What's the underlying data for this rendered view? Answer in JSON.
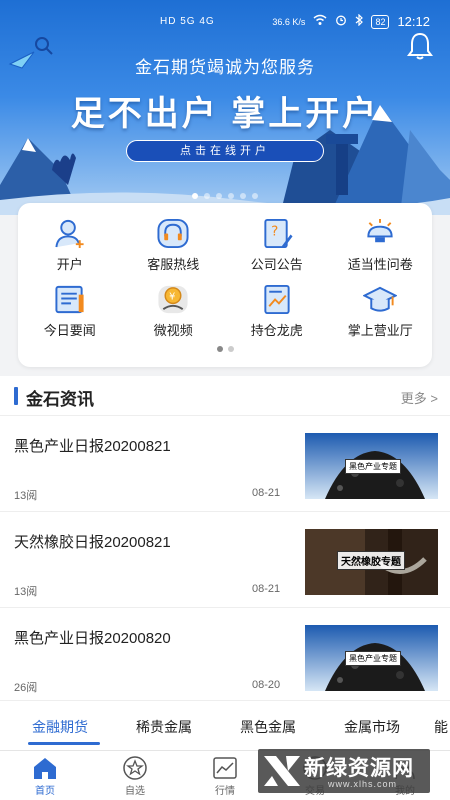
{
  "status_bar": {
    "signal": "HD 5G 4G",
    "speed": "36.6 K/s",
    "battery": "82",
    "time": "12:12"
  },
  "banner": {
    "slogan": "金石期货竭诚为您服务",
    "headline": "足不出户 掌上开户",
    "cta": "点击在线开户",
    "page_count": 6,
    "active_page": 1
  },
  "quick_menu": {
    "items": [
      {
        "label": "开户",
        "icon": "user-add-icon"
      },
      {
        "label": "客服热线",
        "icon": "headset-icon"
      },
      {
        "label": "公司公告",
        "icon": "notice-icon"
      },
      {
        "label": "适当性问卷",
        "icon": "lightbulb-icon"
      },
      {
        "label": "今日要闻",
        "icon": "newspaper-icon"
      },
      {
        "label": "微视频",
        "icon": "video-coin-icon"
      },
      {
        "label": "持仓龙虎",
        "icon": "chart-doc-icon"
      },
      {
        "label": "掌上营业厅",
        "icon": "graduation-cap-icon"
      }
    ],
    "page_count": 2,
    "active_page": 1
  },
  "news": {
    "title": "金石资讯",
    "more": "更多 >",
    "items": [
      {
        "title": "黑色产业日报20200821",
        "views": "13阅",
        "date": "08-21",
        "thumb_label": "黑色产业专题"
      },
      {
        "title": "天然橡胶日报20200821",
        "views": "13阅",
        "date": "08-21",
        "thumb_label": "天然橡胶专题"
      },
      {
        "title": "黑色产业日报20200820",
        "views": "26阅",
        "date": "08-20",
        "thumb_label": "黑色产业专题"
      }
    ]
  },
  "categories": [
    "金融期货",
    "稀贵金属",
    "黑色金属",
    "金属市场",
    "能"
  ],
  "bottom_nav": [
    {
      "label": "首页",
      "icon": "home-icon",
      "active": true
    },
    {
      "label": "自选",
      "icon": "star-icon",
      "active": false
    },
    {
      "label": "行情",
      "icon": "line-chart-icon",
      "active": false
    },
    {
      "label": "交易",
      "icon": "trade-icon",
      "active": false
    },
    {
      "label": "我的",
      "icon": "profile-icon",
      "active": false
    }
  ],
  "watermark": {
    "title": "新绿资源网",
    "url": "www.xlhs.com"
  },
  "colors": {
    "accent": "#2e6bd1",
    "banner_top": "#1e6fd4",
    "banner_bottom": "#a9cdf3"
  }
}
